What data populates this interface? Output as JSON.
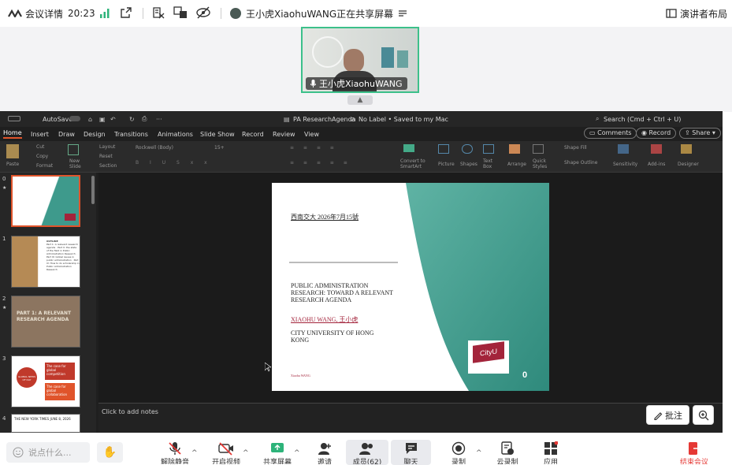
{
  "topbar": {
    "meeting_details": "会议详情",
    "time": "20:23",
    "sharer_text": "王小虎XiaohuWANG正在共享屏幕",
    "layout_label": "演讲者布局"
  },
  "video": {
    "participant_name": "王小虎XiaohuWANG"
  },
  "ppt": {
    "window_title": "PA ResearchAgenda",
    "label_status": "No Label • Saved to my Mac",
    "search": "Search (Cmd + Ctrl + U)",
    "autosave": "AutoSave",
    "tabs": [
      "Home",
      "Insert",
      "Draw",
      "Design",
      "Transitions",
      "Animations",
      "Slide Show",
      "Record",
      "Review",
      "View"
    ],
    "buttons": {
      "comments": "Comments",
      "record": "Record",
      "share": "Share"
    },
    "ribbon": {
      "paste": "Paste",
      "cut": "Cut",
      "copy": "Copy",
      "format": "Format",
      "new_slide": "New Slide",
      "layout": "Layout",
      "reset": "Reset",
      "section": "Section",
      "font": "Rockwell (Body)",
      "size": "15+",
      "convert": "Convert to SmartArt",
      "picture": "Picture",
      "shapes": "Shapes",
      "textbox": "Text Box",
      "arrange": "Arrange",
      "quick_styles": "Quick Styles",
      "shape_fill": "Shape Fill",
      "shape_outline": "Shape Outline",
      "sensitivity": "Sensitivity",
      "addins": "Add-ins",
      "designer": "Designer"
    },
    "thumbnails": [
      {
        "num": "0",
        "mark": "★"
      },
      {
        "num": "1",
        "title": "OUTLINE",
        "text": "Part 1: A relevant research agenda · Part II: the state of the field in Public Administration Research · Part III: Global issues in public administration · Part IV: How to do scholarship in Public Administration Research"
      },
      {
        "num": "2",
        "mark": "★",
        "title": "PART 1: A RELEVANT RESEARCH AGENDA"
      },
      {
        "num": "3",
        "circle": "GLOBAL NEWS OF DAY",
        "a": "The case for global competition",
        "b": "The case for global collaboration"
      },
      {
        "num": "4",
        "headline": "THE NEW YORK TIMES JUNE 8, 2026"
      }
    ],
    "slide": {
      "date": "西南交大 2026年7月15號",
      "title": "PUBLIC ADMINISTRATION RESEARCH: TOWARD A RELEVANT RESEARCH AGENDA",
      "author": "XIAOHU WANG, 王小虎",
      "affil": "CITY UNIVERSITY OF HONG KONG",
      "footer": "Xiaohu WANG",
      "logo": "CityU",
      "page": "0"
    },
    "notes": "Click to add notes"
  },
  "overlay": {
    "annotate": "批注"
  },
  "bottom": {
    "chat_placeholder": "说点什么...",
    "unmute": "解除静音",
    "video": "开启视频",
    "share": "共享屏幕",
    "invite": "邀请",
    "members": "成员(62)",
    "chat": "聊天",
    "record": "录制",
    "cloud": "云录制",
    "apps": "应用",
    "end": "结束会议"
  },
  "colors": {
    "teal": "#3e9a8c",
    "accent_green": "#3cc08a",
    "red": "#e0542b"
  }
}
